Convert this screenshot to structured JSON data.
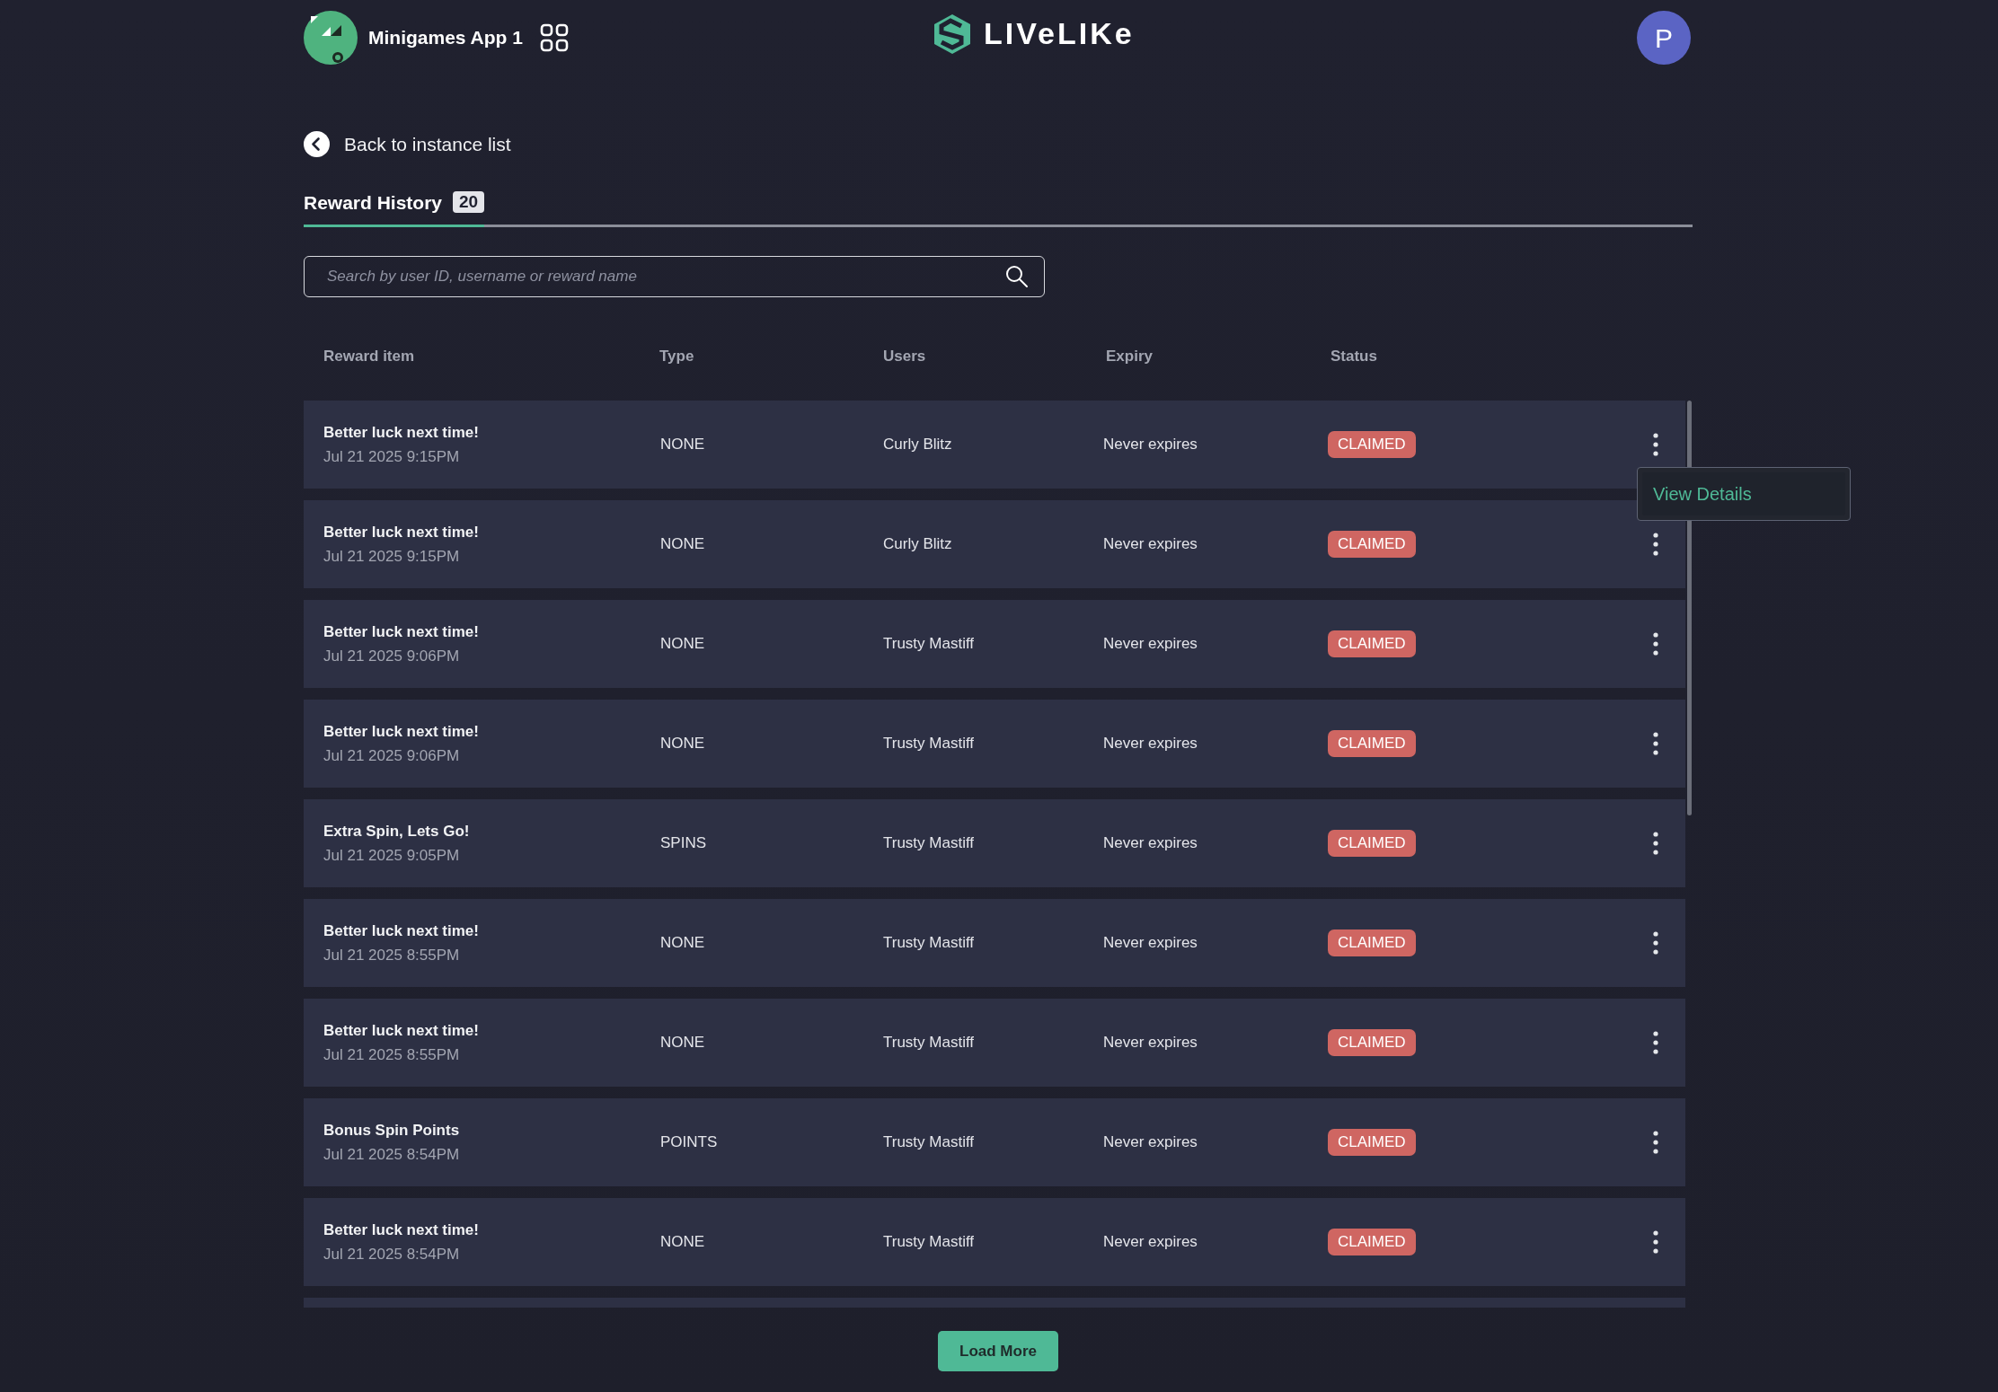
{
  "header": {
    "app_name": "Minigames App 1",
    "logo_text": "LIVeLIKe",
    "avatar_initial": "P"
  },
  "back_link": "Back to instance list",
  "tabs": [
    {
      "label": "Reward History",
      "count": "20",
      "selected": true
    }
  ],
  "search": {
    "placeholder": "Search by user ID, username or reward name"
  },
  "table": {
    "columns": [
      "Reward item",
      "Type",
      "Users",
      "Expiry",
      "Status"
    ],
    "rows": [
      {
        "name": "Better luck next time!",
        "date": "Jul 21 2025 9:15PM",
        "type": "NONE",
        "user": "Curly Blitz",
        "expiry": "Never expires",
        "status": "CLAIMED",
        "menu_open": true
      },
      {
        "name": "Better luck next time!",
        "date": "Jul 21 2025 9:15PM",
        "type": "NONE",
        "user": "Curly Blitz",
        "expiry": "Never expires",
        "status": "CLAIMED",
        "menu_open": false
      },
      {
        "name": "Better luck next time!",
        "date": "Jul 21 2025 9:06PM",
        "type": "NONE",
        "user": "Trusty Mastiff",
        "expiry": "Never expires",
        "status": "CLAIMED",
        "menu_open": false
      },
      {
        "name": "Better luck next time!",
        "date": "Jul 21 2025 9:06PM",
        "type": "NONE",
        "user": "Trusty Mastiff",
        "expiry": "Never expires",
        "status": "CLAIMED",
        "menu_open": false
      },
      {
        "name": "Extra Spin, Lets Go!",
        "date": "Jul 21 2025 9:05PM",
        "type": "SPINS",
        "user": "Trusty Mastiff",
        "expiry": "Never expires",
        "status": "CLAIMED",
        "menu_open": false
      },
      {
        "name": "Better luck next time!",
        "date": "Jul 21 2025 8:55PM",
        "type": "NONE",
        "user": "Trusty Mastiff",
        "expiry": "Never expires",
        "status": "CLAIMED",
        "menu_open": false
      },
      {
        "name": "Better luck next time!",
        "date": "Jul 21 2025 8:55PM",
        "type": "NONE",
        "user": "Trusty Mastiff",
        "expiry": "Never expires",
        "status": "CLAIMED",
        "menu_open": false
      },
      {
        "name": "Bonus Spin Points",
        "date": "Jul 21 2025 8:54PM",
        "type": "POINTS",
        "user": "Trusty Mastiff",
        "expiry": "Never expires",
        "status": "CLAIMED",
        "menu_open": false
      },
      {
        "name": "Better luck next time!",
        "date": "Jul 21 2025 8:54PM",
        "type": "NONE",
        "user": "Trusty Mastiff",
        "expiry": "Never expires",
        "status": "CLAIMED",
        "menu_open": false
      }
    ]
  },
  "row_menu": {
    "items": [
      "View Details"
    ]
  },
  "load_more": "Load More"
}
